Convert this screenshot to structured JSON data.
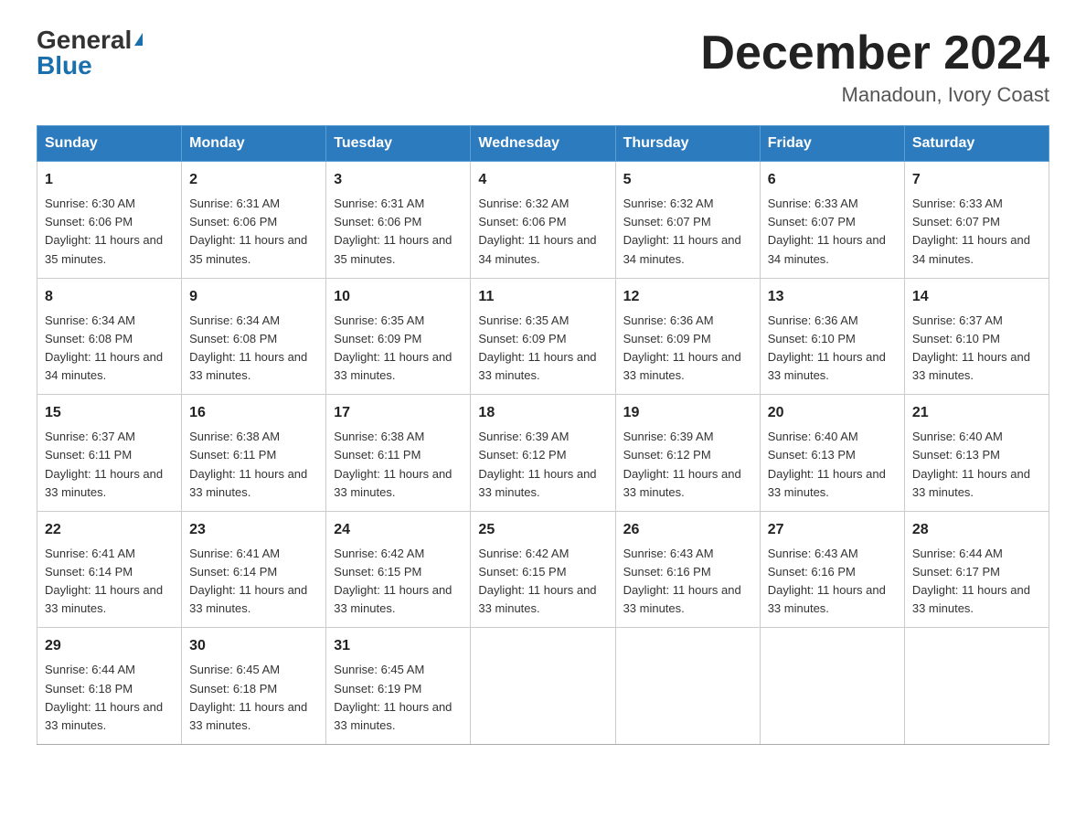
{
  "logo": {
    "general": "General",
    "blue": "Blue",
    "triangle": "▼"
  },
  "title": "December 2024",
  "subtitle": "Manadoun, Ivory Coast",
  "days_header": [
    "Sunday",
    "Monday",
    "Tuesday",
    "Wednesday",
    "Thursday",
    "Friday",
    "Saturday"
  ],
  "weeks": [
    [
      {
        "day": "1",
        "sunrise": "6:30 AM",
        "sunset": "6:06 PM",
        "daylight": "11 hours and 35 minutes."
      },
      {
        "day": "2",
        "sunrise": "6:31 AM",
        "sunset": "6:06 PM",
        "daylight": "11 hours and 35 minutes."
      },
      {
        "day": "3",
        "sunrise": "6:31 AM",
        "sunset": "6:06 PM",
        "daylight": "11 hours and 35 minutes."
      },
      {
        "day": "4",
        "sunrise": "6:32 AM",
        "sunset": "6:06 PM",
        "daylight": "11 hours and 34 minutes."
      },
      {
        "day": "5",
        "sunrise": "6:32 AM",
        "sunset": "6:07 PM",
        "daylight": "11 hours and 34 minutes."
      },
      {
        "day": "6",
        "sunrise": "6:33 AM",
        "sunset": "6:07 PM",
        "daylight": "11 hours and 34 minutes."
      },
      {
        "day": "7",
        "sunrise": "6:33 AM",
        "sunset": "6:07 PM",
        "daylight": "11 hours and 34 minutes."
      }
    ],
    [
      {
        "day": "8",
        "sunrise": "6:34 AM",
        "sunset": "6:08 PM",
        "daylight": "11 hours and 34 minutes."
      },
      {
        "day": "9",
        "sunrise": "6:34 AM",
        "sunset": "6:08 PM",
        "daylight": "11 hours and 33 minutes."
      },
      {
        "day": "10",
        "sunrise": "6:35 AM",
        "sunset": "6:09 PM",
        "daylight": "11 hours and 33 minutes."
      },
      {
        "day": "11",
        "sunrise": "6:35 AM",
        "sunset": "6:09 PM",
        "daylight": "11 hours and 33 minutes."
      },
      {
        "day": "12",
        "sunrise": "6:36 AM",
        "sunset": "6:09 PM",
        "daylight": "11 hours and 33 minutes."
      },
      {
        "day": "13",
        "sunrise": "6:36 AM",
        "sunset": "6:10 PM",
        "daylight": "11 hours and 33 minutes."
      },
      {
        "day": "14",
        "sunrise": "6:37 AM",
        "sunset": "6:10 PM",
        "daylight": "11 hours and 33 minutes."
      }
    ],
    [
      {
        "day": "15",
        "sunrise": "6:37 AM",
        "sunset": "6:11 PM",
        "daylight": "11 hours and 33 minutes."
      },
      {
        "day": "16",
        "sunrise": "6:38 AM",
        "sunset": "6:11 PM",
        "daylight": "11 hours and 33 minutes."
      },
      {
        "day": "17",
        "sunrise": "6:38 AM",
        "sunset": "6:11 PM",
        "daylight": "11 hours and 33 minutes."
      },
      {
        "day": "18",
        "sunrise": "6:39 AM",
        "sunset": "6:12 PM",
        "daylight": "11 hours and 33 minutes."
      },
      {
        "day": "19",
        "sunrise": "6:39 AM",
        "sunset": "6:12 PM",
        "daylight": "11 hours and 33 minutes."
      },
      {
        "day": "20",
        "sunrise": "6:40 AM",
        "sunset": "6:13 PM",
        "daylight": "11 hours and 33 minutes."
      },
      {
        "day": "21",
        "sunrise": "6:40 AM",
        "sunset": "6:13 PM",
        "daylight": "11 hours and 33 minutes."
      }
    ],
    [
      {
        "day": "22",
        "sunrise": "6:41 AM",
        "sunset": "6:14 PM",
        "daylight": "11 hours and 33 minutes."
      },
      {
        "day": "23",
        "sunrise": "6:41 AM",
        "sunset": "6:14 PM",
        "daylight": "11 hours and 33 minutes."
      },
      {
        "day": "24",
        "sunrise": "6:42 AM",
        "sunset": "6:15 PM",
        "daylight": "11 hours and 33 minutes."
      },
      {
        "day": "25",
        "sunrise": "6:42 AM",
        "sunset": "6:15 PM",
        "daylight": "11 hours and 33 minutes."
      },
      {
        "day": "26",
        "sunrise": "6:43 AM",
        "sunset": "6:16 PM",
        "daylight": "11 hours and 33 minutes."
      },
      {
        "day": "27",
        "sunrise": "6:43 AM",
        "sunset": "6:16 PM",
        "daylight": "11 hours and 33 minutes."
      },
      {
        "day": "28",
        "sunrise": "6:44 AM",
        "sunset": "6:17 PM",
        "daylight": "11 hours and 33 minutes."
      }
    ],
    [
      {
        "day": "29",
        "sunrise": "6:44 AM",
        "sunset": "6:18 PM",
        "daylight": "11 hours and 33 minutes."
      },
      {
        "day": "30",
        "sunrise": "6:45 AM",
        "sunset": "6:18 PM",
        "daylight": "11 hours and 33 minutes."
      },
      {
        "day": "31",
        "sunrise": "6:45 AM",
        "sunset": "6:19 PM",
        "daylight": "11 hours and 33 minutes."
      },
      null,
      null,
      null,
      null
    ]
  ]
}
